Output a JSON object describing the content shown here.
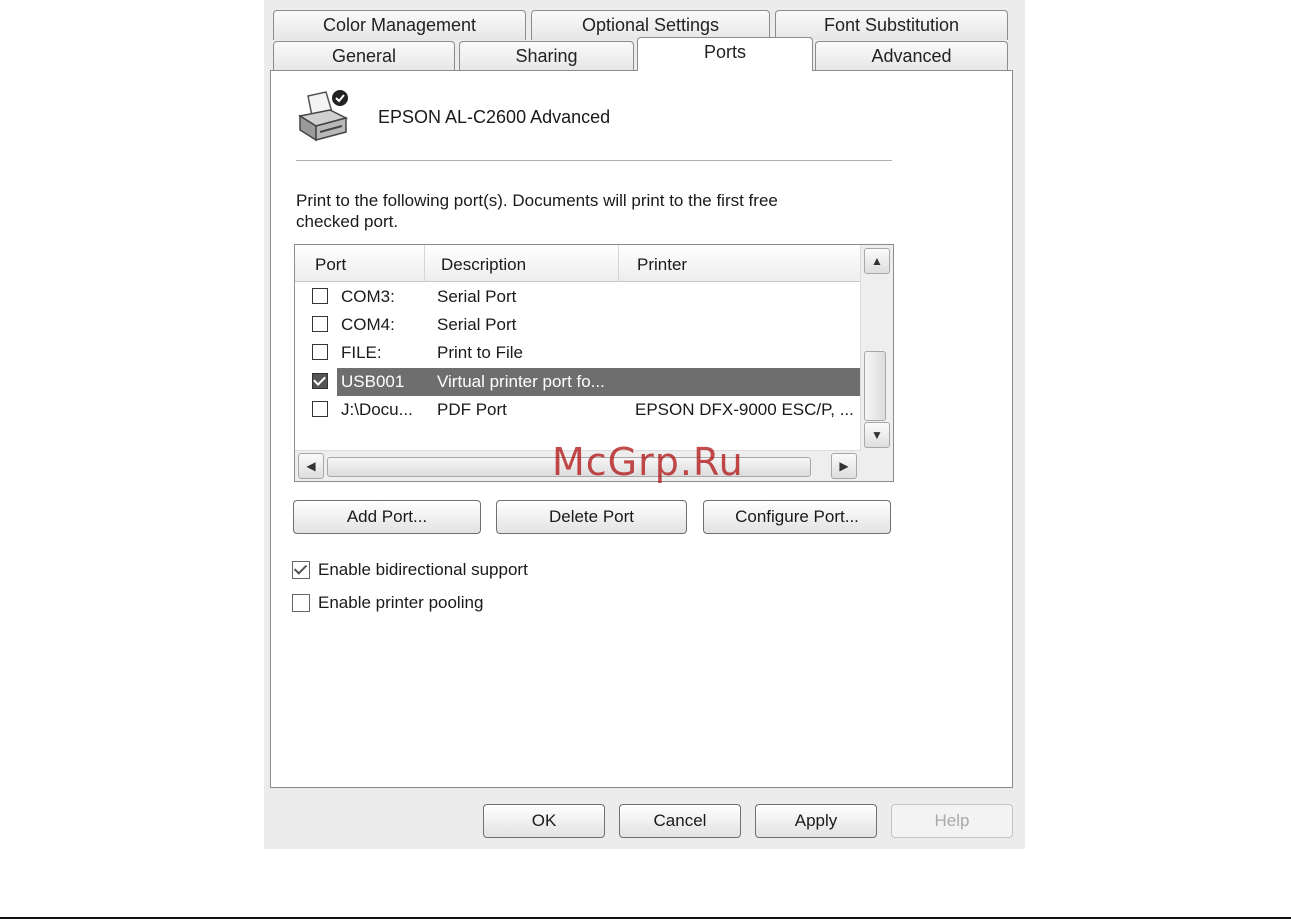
{
  "tabs_row1": [
    "Color Management",
    "Optional Settings",
    "Font Substitution"
  ],
  "tabs_row2": [
    "General",
    "Sharing",
    "Ports",
    "Advanced"
  ],
  "active_tab": "Ports",
  "printer": {
    "name": "EPSON AL-C2600 Advanced",
    "icon": "printer-icon"
  },
  "description": "Print to the following port(s). Documents will print to the first free checked port.",
  "ports_table": {
    "columns": [
      "Port",
      "Description",
      "Printer"
    ],
    "rows": [
      {
        "port": "COM3:",
        "description": "Serial Port",
        "printer": "",
        "checked": false,
        "selected": false
      },
      {
        "port": "COM4:",
        "description": "Serial Port",
        "printer": "",
        "checked": false,
        "selected": false
      },
      {
        "port": "FILE:",
        "description": "Print to File",
        "printer": "",
        "checked": false,
        "selected": false
      },
      {
        "port": "USB001",
        "description": "Virtual printer port fo...",
        "printer": "",
        "checked": true,
        "selected": true
      },
      {
        "port": "J:\\Docu...",
        "description": "PDF Port",
        "printer": "EPSON DFX-9000 ESC/P, ...",
        "checked": false,
        "selected": false
      }
    ]
  },
  "port_buttons": {
    "add": "Add Port...",
    "delete": "Delete Port",
    "configure": "Configure Port..."
  },
  "options": {
    "bidirectional": {
      "label": "Enable bidirectional support",
      "checked": true
    },
    "pooling": {
      "label": "Enable printer pooling",
      "checked": false
    }
  },
  "dialog_buttons": {
    "ok": "OK",
    "cancel": "Cancel",
    "apply": "Apply",
    "help": "Help"
  },
  "watermark": "McGrp.Ru",
  "colors": {
    "selection": "#6e6e6e",
    "dialog_bg": "#ececec",
    "watermark": "#b01010"
  }
}
